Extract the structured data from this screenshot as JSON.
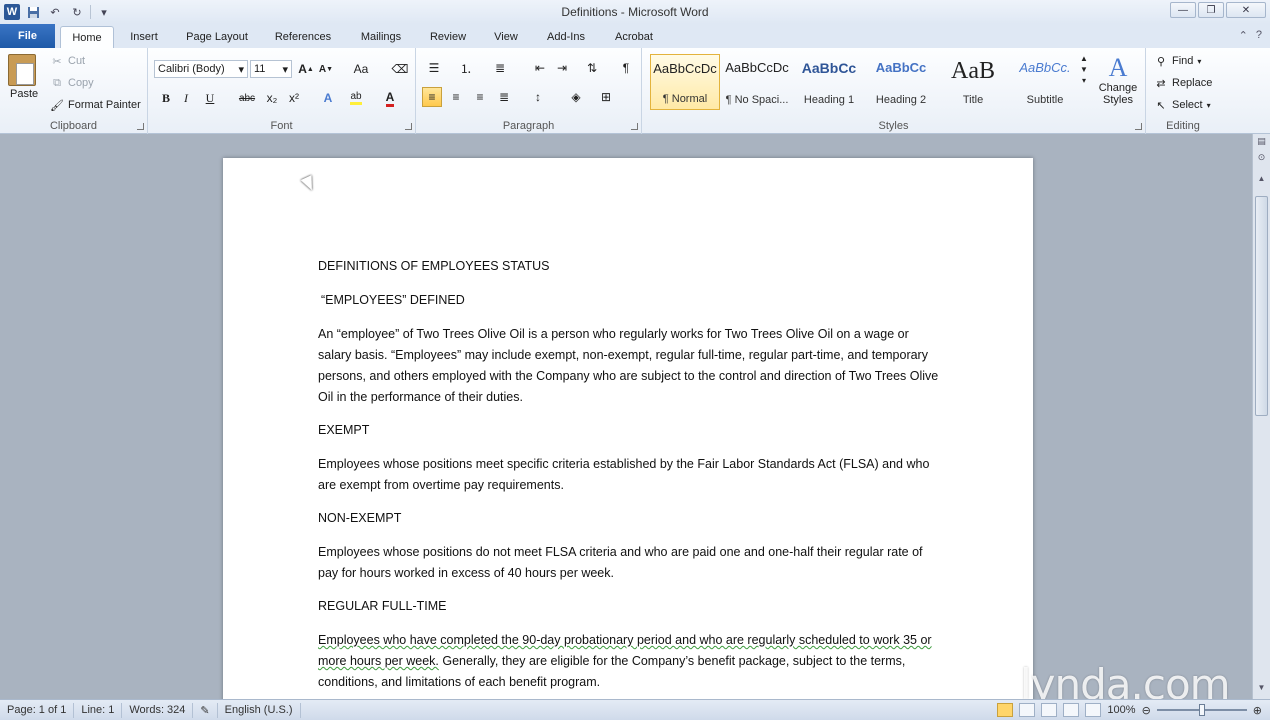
{
  "window": {
    "title": "Definitions - Microsoft Word"
  },
  "qat": {
    "word_icon": "W",
    "save_icon": "save-icon",
    "undo_icon": "undo-icon",
    "redo_icon": "redo-icon",
    "customize_icon": "customize-icon"
  },
  "tabs": {
    "file": "File",
    "items": [
      "Home",
      "Insert",
      "Page Layout",
      "References",
      "Mailings",
      "Review",
      "View",
      "Add-Ins",
      "Acrobat"
    ],
    "active": "Home"
  },
  "clipboard": {
    "label": "Clipboard",
    "paste": "Paste",
    "cut": "Cut",
    "copy": "Copy",
    "format_painter": "Format Painter"
  },
  "font": {
    "label": "Font",
    "family": "Calibri (Body)",
    "size": "11",
    "bold": "B",
    "italic": "I",
    "underline": "U",
    "strikethrough": "abc",
    "subscript": "x₂",
    "superscript": "x²",
    "grow": "A",
    "shrink": "A",
    "change_case": "Aa",
    "text_effects": "A",
    "highlight": "ab",
    "font_color": "A",
    "font_color_hex": "#d42020",
    "highlight_hex": "#ffef3a"
  },
  "paragraph": {
    "label": "Paragraph"
  },
  "styles": {
    "label": "Styles",
    "items": [
      {
        "preview": "AaBbCcDc",
        "name": "¶ Normal"
      },
      {
        "preview": "AaBbCcDc",
        "name": "¶ No Spaci..."
      },
      {
        "preview": "AaBbCc",
        "name": "Heading 1"
      },
      {
        "preview": "AaBbCc",
        "name": "Heading 2"
      },
      {
        "preview": "AaB",
        "name": "Title"
      },
      {
        "preview": "AaBbCc.",
        "name": "Subtitle"
      }
    ],
    "change_styles": "Change Styles"
  },
  "editing": {
    "label": "Editing",
    "find": "Find",
    "replace": "Replace",
    "select": "Select"
  },
  "document": {
    "title": "DEFINITIONS OF EMPLOYEES STATUS",
    "s1_heading": "“EMPLOYEES” DEFINED",
    "s1_body": "An “employee” of Two Trees Olive Oil is a person who regularly works for Two Trees Olive Oil on a wage or salary basis. “Employees” may include exempt, non-exempt, regular full-time, regular part-time, and temporary persons, and others employed with the Company who are subject to the control and direction of Two Trees Olive Oil in the performance of their duties.",
    "s2_heading": "EXEMPT",
    "s2_body": "Employees whose positions meet specific criteria established by the Fair Labor Standards Act (FLSA) and who are exempt from overtime pay requirements.",
    "s3_heading": "NON-EXEMPT",
    "s3_body": "Employees whose positions do not meet FLSA criteria and who are paid one and one-half their regular rate of pay for hours worked in excess of 40 hours per week.",
    "s4_heading": "REGULAR FULL-TIME",
    "s4_body_marked": "Employees who have completed the 90-day probationary period and who are regularly scheduled to work 35 or more hours per week.",
    "s4_body_rest": " Generally, they are eligible for the Company’s benefit package, subject to the terms, conditions, and limitations of each benefit program."
  },
  "status": {
    "page": "Page: 1 of 1",
    "line": "Line: 1",
    "words": "Words: 324",
    "language": "English (U.S.)",
    "zoom": "100%",
    "zoom_percent": 100
  },
  "watermark": "lynda.com"
}
